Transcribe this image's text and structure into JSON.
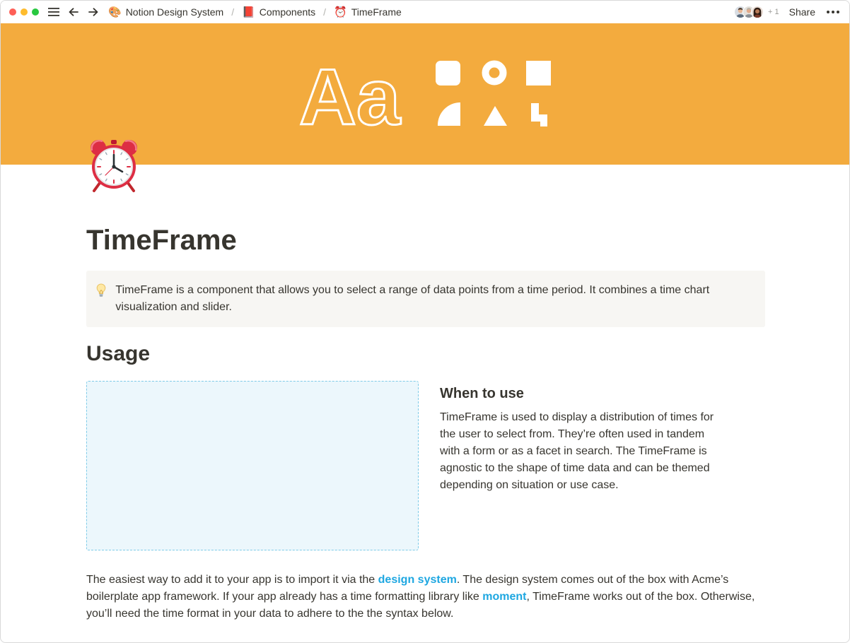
{
  "breadcrumbs": [
    {
      "icon": "palette-emoji",
      "emoji": "🎨",
      "label": "Notion Design System"
    },
    {
      "icon": "book-emoji",
      "emoji": "📕",
      "label": "Components"
    },
    {
      "icon": "alarm-clock-emoji",
      "emoji": "⏰",
      "label": "TimeFrame"
    }
  ],
  "topbar": {
    "extra_collaborators": "+ 1",
    "share_label": "Share"
  },
  "cover": {
    "text": "Aa",
    "background_color": "#f3ab3e"
  },
  "page": {
    "icon": "alarm-clock",
    "title": "TimeFrame"
  },
  "callout": {
    "icon": "lightbulb-icon",
    "text": "TimeFrame is a component that allows you to select a range of data points from a time period. It combines a time chart visualization and slider."
  },
  "usage": {
    "heading": "Usage",
    "when_heading": "When to use",
    "when_text": "TimeFrame is used to display a distribution of times for the user to select from. They’re often used in tandem with a form or as a facet in search. The TimeFrame is agnostic to the shape of time data and can be themed depending on situation or use case."
  },
  "body_paragraph": {
    "part1": "The easiest way to add it to your app is to import it via the ",
    "link1": "design system",
    "part2": ". The design system comes out of the box with Acme’s boilerplate app framework. If your app already has a time formatting library like ",
    "link2": "moment",
    "part3": ", TimeFrame works out of the box. Otherwise, you’ll need the time format in your data to adhere to the the syntax below."
  },
  "colors": {
    "link": "#1ea7e1",
    "callout_bg": "#f7f6f3",
    "placeholder_bg": "#ecf7fc"
  }
}
